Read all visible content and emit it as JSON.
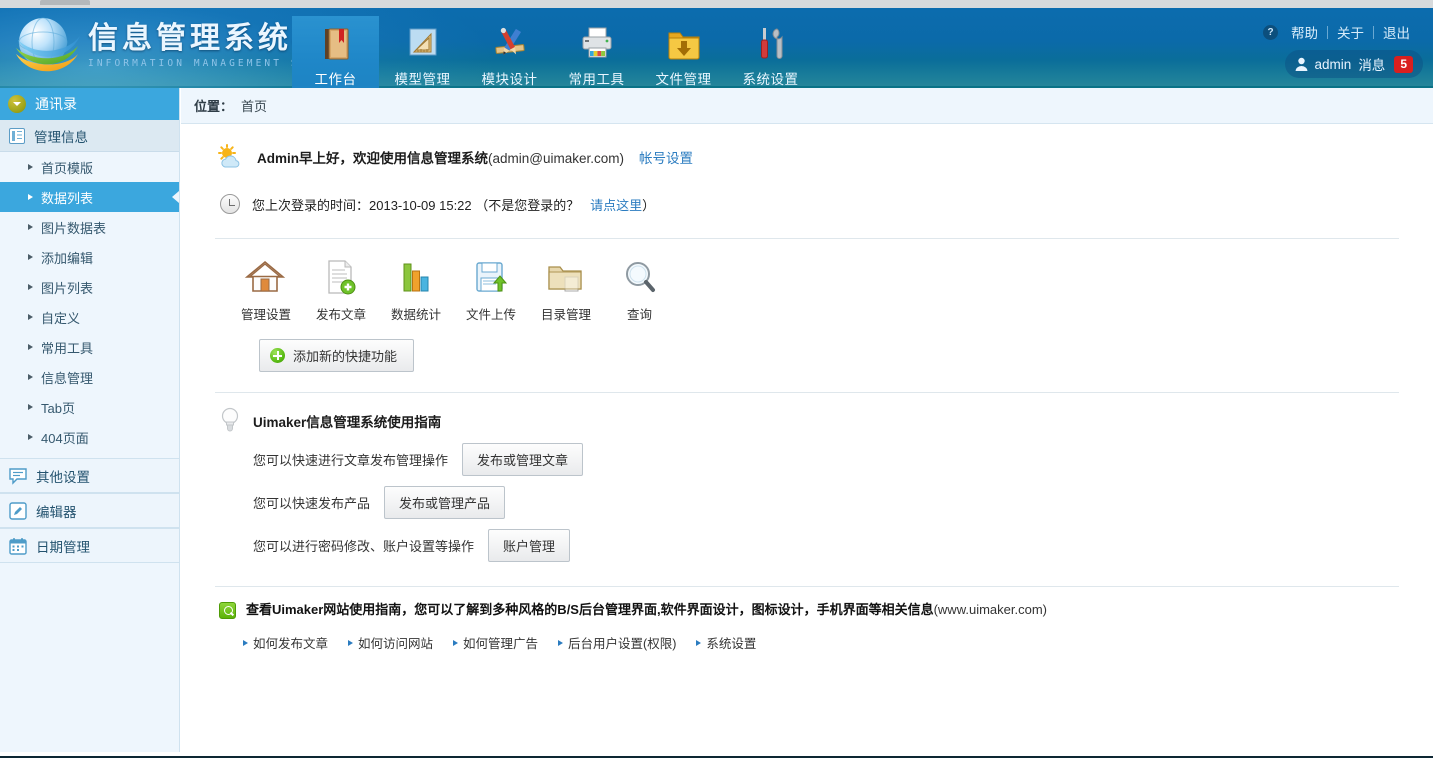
{
  "header": {
    "brand_title": "信息管理系统界面",
    "brand_subtitle": "INFORMATION MANAGEMENT SYSTEM GUI",
    "logo_icon": "globe-swoosh-logo",
    "nav": [
      {
        "label": "工作台",
        "icon": "book-icon",
        "active": true
      },
      {
        "label": "模型管理",
        "icon": "ruler-triangle-icon",
        "active": false
      },
      {
        "label": "模块设计",
        "icon": "pencil-brush-icon",
        "active": false
      },
      {
        "label": "常用工具",
        "icon": "printer-icon",
        "active": false
      },
      {
        "label": "文件管理",
        "icon": "folder-download-icon",
        "active": false
      },
      {
        "label": "系统设置",
        "icon": "screwdriver-wrench-icon",
        "active": false
      }
    ],
    "links": {
      "help": "帮助",
      "about": "关于",
      "logout": "退出",
      "help_icon": "question-mark-icon"
    },
    "user": {
      "name": "admin",
      "message_label": "消息",
      "message_count": "5",
      "avatar_icon": "user-icon"
    }
  },
  "sidebar": {
    "head": {
      "label": "通讯录",
      "icon": "chevron-down-circle-icon"
    },
    "group": {
      "label": "管理信息",
      "icon": "list-box-icon"
    },
    "items": [
      {
        "label": "首页模版",
        "selected": false
      },
      {
        "label": "数据列表",
        "selected": true
      },
      {
        "label": "图片数据表",
        "selected": false
      },
      {
        "label": "添加编辑",
        "selected": false
      },
      {
        "label": "图片列表",
        "selected": false
      },
      {
        "label": "自定义",
        "selected": false
      },
      {
        "label": "常用工具",
        "selected": false
      },
      {
        "label": "信息管理",
        "selected": false
      },
      {
        "label": "Tab页",
        "selected": false
      },
      {
        "label": "404页面",
        "selected": false
      }
    ],
    "sections": [
      {
        "label": "其他设置",
        "icon": "speech-bubble-icon"
      },
      {
        "label": "编辑器",
        "icon": "pencil-square-icon"
      },
      {
        "label": "日期管理",
        "icon": "calendar-icon"
      }
    ]
  },
  "main": {
    "breadcrumb": {
      "label": "位置：",
      "current": "首页"
    },
    "welcome": {
      "icon": "sun-cloud-icon",
      "greeting_bold": "Admin早上好，欢迎使用信息管理系统",
      "email": "(admin@uimaker.com)",
      "account_link": "帐号设置"
    },
    "last_login": {
      "icon": "clock-icon",
      "prefix": "您上次登录的时间：2013-10-09 15:22 （不是您登录的？",
      "link": "请点这里",
      "suffix": "）"
    },
    "shortcuts": [
      {
        "label": "管理设置",
        "icon": "house-icon"
      },
      {
        "label": "发布文章",
        "icon": "document-add-icon"
      },
      {
        "label": "数据统计",
        "icon": "bar-chart-icon"
      },
      {
        "label": "文件上传",
        "icon": "floppy-upload-icon"
      },
      {
        "label": "目录管理",
        "icon": "folder-icon"
      },
      {
        "label": "查询",
        "icon": "magnifier-icon"
      }
    ],
    "add_shortcut_button": "添加新的快捷功能",
    "guide": {
      "icon": "lightbulb-icon",
      "title": "Uimaker信息管理系统使用指南",
      "rows": [
        {
          "text": "您可以快速进行文章发布管理操作",
          "button": "发布或管理文章"
        },
        {
          "text": "您可以快速发布产品",
          "button": "发布或管理产品"
        },
        {
          "text": "您可以进行密码修改、账户设置等操作",
          "button": "账户管理"
        }
      ]
    },
    "notice": {
      "icon": "green-magnifier-icon",
      "bold_text": "查看Uimaker网站使用指南，您可以了解到多种风格的B/S后台管理界面,软件界面设计，图标设计，手机界面等相关信息",
      "url_text": "(www.uimaker.com)"
    },
    "sublinks": [
      "如何发布文章",
      "如何访问网站",
      "如何管理广告",
      "后台用户设置(权限)",
      "系统设置"
    ]
  },
  "colors": {
    "header_blue": "#0c6cae",
    "header_teal": "#0a7286",
    "active_tab": "#1f87c8",
    "active_tab_underline": "#7ac70c",
    "sidebar_bg": "#eef6fd",
    "sidebar_selected": "#3ba7de",
    "link_blue": "#2b7cc0",
    "badge_red": "#d91f1f"
  }
}
